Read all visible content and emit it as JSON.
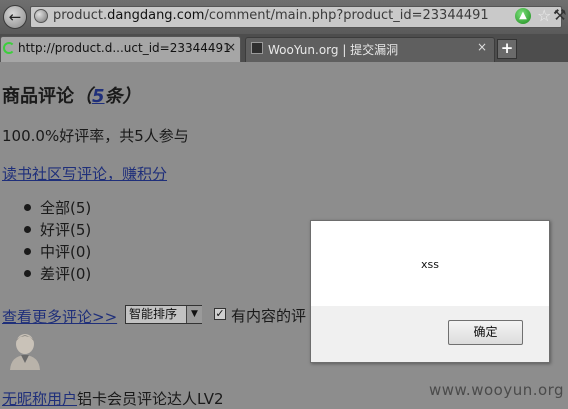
{
  "browser": {
    "url_prefix": "product.",
    "url_domain": "dangdang.com",
    "url_path": "/comment/main.php?product_id=23344491",
    "tabs": [
      {
        "label": "http://product.d...uct_id=23344491",
        "close": "×"
      },
      {
        "label": "WooYun.org | 提交漏洞",
        "close": "×"
      }
    ],
    "new_tab": "+"
  },
  "page": {
    "heading_main": "商品评论",
    "heading_open": "（",
    "heading_count": "5",
    "heading_unit": "条）",
    "rating_summary": "100.0%好评率，共5人参与",
    "write_link": "读书社区写评论，赚积分",
    "filters": [
      "全部(5)",
      "好评(5)",
      "中评(0)",
      "差评(0)"
    ],
    "more_link": "查看更多评论>>",
    "sort_selected": "智能排序",
    "checkbox_label": "有内容的评",
    "bottom_link": "无昵称用户",
    "bottom_text": "铝卡会员评论达人LV2"
  },
  "dialog": {
    "message": "xss",
    "ok_label": "确定"
  },
  "watermark": "www.wooyun.org"
}
